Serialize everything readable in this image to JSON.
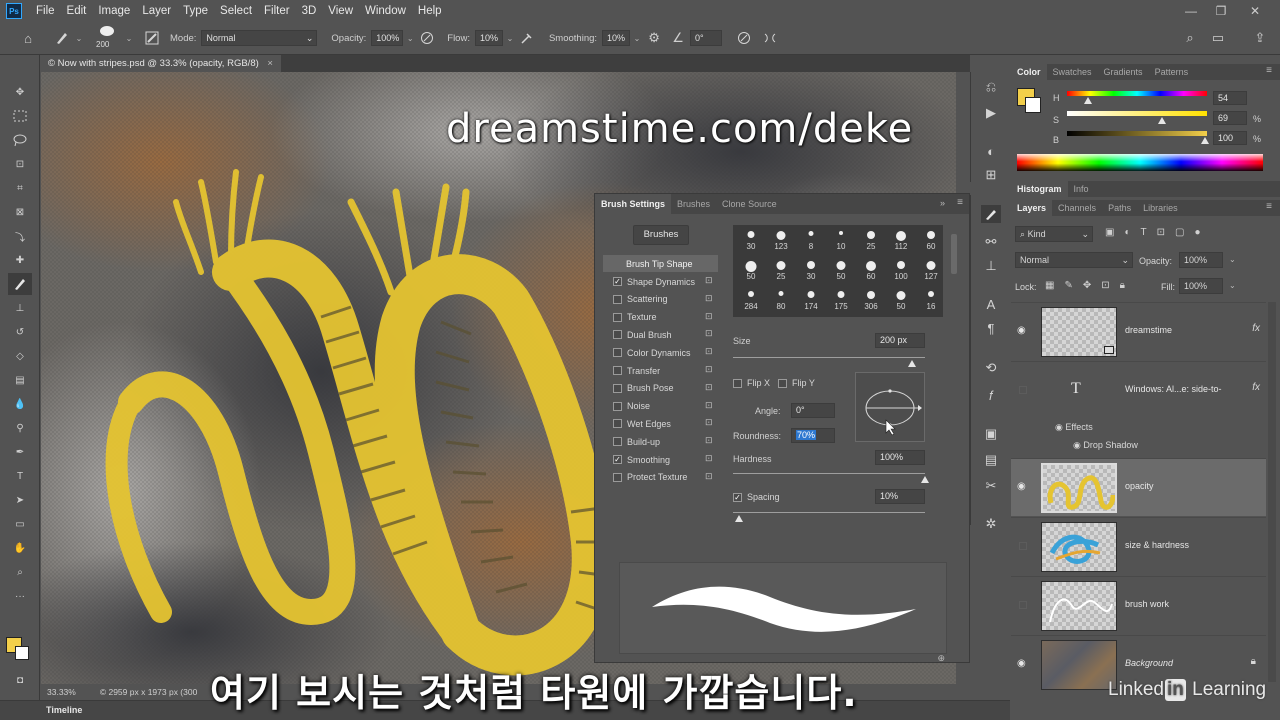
{
  "app": {
    "logo": "Ps"
  },
  "menubar": {
    "items": [
      "File",
      "Edit",
      "Image",
      "Layer",
      "Type",
      "Select",
      "Filter",
      "3D",
      "View",
      "Window",
      "Help"
    ]
  },
  "window_controls": {
    "minimize": "—",
    "restore": "❐",
    "close": "✕"
  },
  "options_bar": {
    "brush_size": "200",
    "mode_label": "Mode:",
    "mode_value": "Normal",
    "opacity_label": "Opacity:",
    "opacity_value": "100%",
    "flow_label": "Flow:",
    "flow_value": "10%",
    "smoothing_label": "Smoothing:",
    "smoothing_value": "10%",
    "angle_value": "0°"
  },
  "document": {
    "tab_title": "© Now with stripes.psd @ 33.3% (opacity, RGB/8)",
    "close": "×"
  },
  "status": {
    "zoom": "33.33%",
    "doc_info": "© 2959 px x 1973 px (300"
  },
  "timeline": {
    "label": "Timeline"
  },
  "overlay": {
    "watermark": "dreamstime.com/deke",
    "subtitle": "여기 보시는 것처럼 타원에 가깝습니다.",
    "brand_a": "Linked",
    "brand_in": "in",
    "brand_b": " Learning"
  },
  "brush_panel": {
    "tabs": [
      "Brush Settings",
      "Brushes",
      "Clone Source"
    ],
    "brushes_button": "Brushes",
    "tip_shape_header": "Brush Tip Shape",
    "options": [
      {
        "label": "Shape Dynamics",
        "checked": true
      },
      {
        "label": "Scattering",
        "checked": false
      },
      {
        "label": "Texture",
        "checked": false
      },
      {
        "label": "Dual Brush",
        "checked": false
      },
      {
        "label": "Color Dynamics",
        "checked": false
      },
      {
        "label": "Transfer",
        "checked": false
      },
      {
        "label": "Brush Pose",
        "checked": false
      },
      {
        "label": "Noise",
        "checked": false
      },
      {
        "label": "Wet Edges",
        "checked": false
      },
      {
        "label": "Build-up",
        "checked": false
      },
      {
        "label": "Smoothing",
        "checked": true
      },
      {
        "label": "Protect Texture",
        "checked": false
      }
    ],
    "presets": [
      "30",
      "123",
      "8",
      "10",
      "25",
      "112",
      "60",
      "50",
      "25",
      "30",
      "50",
      "60",
      "100",
      "127",
      "284",
      "80",
      "174",
      "175",
      "306",
      "50",
      "16"
    ],
    "size_label": "Size",
    "size_value": "200 px",
    "size_level": 0.93,
    "flip_x": "Flip X",
    "flip_y": "Flip Y",
    "angle_label": "Angle:",
    "angle_value": "0°",
    "roundness_label": "Roundness:",
    "roundness_value": "70%",
    "hardness_label": "Hardness",
    "hardness_value": "100%",
    "hardness_level": 1.0,
    "spacing_label": "Spacing",
    "spacing_value": "10%",
    "spacing_level": 0.03
  },
  "color_panel": {
    "tabs": [
      "Color",
      "Swatches",
      "Gradients",
      "Patterns"
    ],
    "foreground": "#f3cf4a",
    "h_label": "H",
    "h_value": "54",
    "s_label": "S",
    "s_value": "69",
    "b_label": "B",
    "b_value": "100",
    "pct": "%"
  },
  "histogram_tabs": [
    "Histogram",
    "Info"
  ],
  "layers_panel": {
    "tabs": [
      "Layers",
      "Channels",
      "Paths",
      "Libraries"
    ],
    "kind_filter": "Kind",
    "blend_mode": "Normal",
    "opacity_label": "Opacity:",
    "opacity_value": "100%",
    "lock_label": "Lock:",
    "fill_label": "Fill:",
    "fill_value": "100%",
    "layers": [
      {
        "name": "dreamstime",
        "visible": true,
        "fx": "fx"
      },
      {
        "name": "Windows: Al...e: side-to-",
        "visible": false,
        "fx": "fx",
        "type_glyph": "T"
      },
      {
        "name": "opacity",
        "visible": true,
        "fx": ""
      },
      {
        "name": "size & hardness",
        "visible": false,
        "fx": ""
      },
      {
        "name": "brush work",
        "visible": false,
        "fx": ""
      },
      {
        "name": "Background",
        "visible": true,
        "fx": ""
      }
    ],
    "effects_label": "Effects",
    "drop_shadow_label": "Drop Shadow"
  }
}
